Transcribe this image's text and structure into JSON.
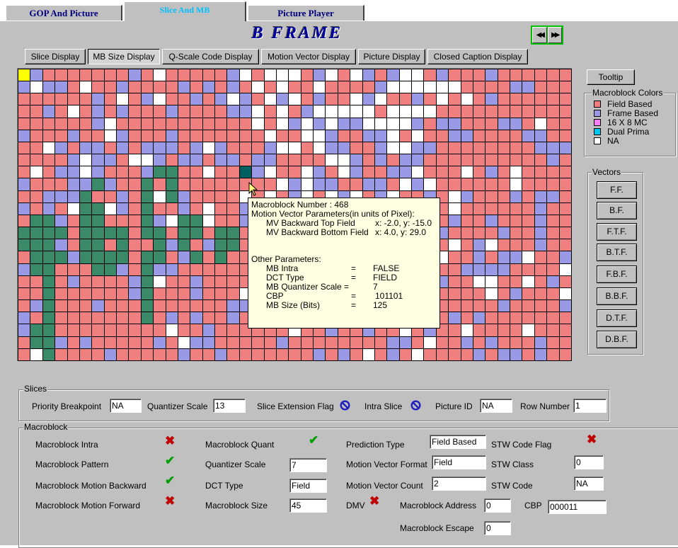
{
  "tabs": [
    "GOP  And  Picture",
    "Slice And  MB",
    "Picture  Player"
  ],
  "title": "B FRAME",
  "display_buttons": [
    "Slice Display",
    "MB Size Display",
    "Q-Scale Code Display",
    "Motion Vector Display",
    "Picture Display",
    "Closed Caption Display"
  ],
  "tooltip_button": "Tooltip",
  "colors": {
    "field_based": "#f08080",
    "frame_based": "#9999e6",
    "mc16x8": "#ff80ff",
    "dual_prime": "#00c8f0",
    "na": "#ffffff",
    "green_block": "#3a8a6a",
    "yellow_block": "#ffff00",
    "selected_block": "#006060"
  },
  "legend": {
    "title": "Macroblock Colors",
    "items": [
      "Field Based",
      "Frame Based",
      "16 X 8 MC",
      "Dual Prima",
      "NA"
    ]
  },
  "vectors": {
    "title": "Vectors",
    "buttons": [
      "F.F.",
      "B.F.",
      "F.T.F.",
      "B.T.F.",
      "F.B.F.",
      "B.B.F.",
      "D.T.F.",
      "D.B.F."
    ]
  },
  "tooltip": {
    "mb_number": "Macroblock Number : 468",
    "mv_header": "Motion Vector Parameters(in units of Pixel):",
    "mv1_label": "MV Backward Top Field",
    "mv1_value": "x: -2.0, y: -15.0",
    "mv2_label": "MV Backward Bottom Field",
    "mv2_value": "x: 4.0, y: 29.0",
    "other_header": "Other Parameters:",
    "rows": [
      {
        "label": "MB Intra",
        "eq": "=",
        "value": "FALSE"
      },
      {
        "label": "DCT Type",
        "eq": "=",
        "value": "FIELD"
      },
      {
        "label": "MB Quantizer Scale =",
        "eq": "",
        "value": "7"
      },
      {
        "label": "CBP",
        "eq": "=",
        "value": "101101"
      },
      {
        "label": "MB Size (Bits)",
        "eq": "=",
        "value": "125"
      }
    ]
  },
  "slices": {
    "title": "Slices",
    "priority_breakpoint_label": "Priority Breakpoint",
    "priority_breakpoint": "NA",
    "quantizer_scale_label": "Quantizer Scale",
    "quantizer_scale": "13",
    "slice_extension_flag_label": "Slice Extension Flag",
    "intra_slice_label": "Intra Slice",
    "picture_id_label": "Picture ID",
    "picture_id": "NA",
    "row_number_label": "Row Number",
    "row_number": "1"
  },
  "macroblock": {
    "title": "Macroblock",
    "intra_label": "Macroblock Intra",
    "pattern_label": "Macroblock Pattern",
    "motion_backward_label": "Macroblock Motion Backward",
    "motion_forward_label": "Macroblock Motion Forward",
    "quant_label": "Macroblock Quant",
    "quantizer_scale_label": "Quantizer Scale",
    "quantizer_scale": "7",
    "dct_type_label": "DCT Type",
    "dct_type": "Field",
    "size_label": "Macroblock Size",
    "size": "45",
    "prediction_type_label": "Prediction Type",
    "prediction_type": "Field Based",
    "mv_format_label": "Motion Vector Format",
    "mv_format": "Field",
    "mv_count_label": "Motion Vector Count",
    "mv_count": "2",
    "dmv_label": "DMV",
    "address_label": "Macroblock Address",
    "address": "0",
    "escape_label": "Macroblock Escape",
    "escape": "0",
    "stw_flag_label": "STW Code Flag",
    "stw_class_label": "STW Class",
    "stw_class": "0",
    "stw_code_label": "STW Code",
    "stw_code": "NA",
    "cbp_label": "CBP",
    "cbp": "000011"
  }
}
